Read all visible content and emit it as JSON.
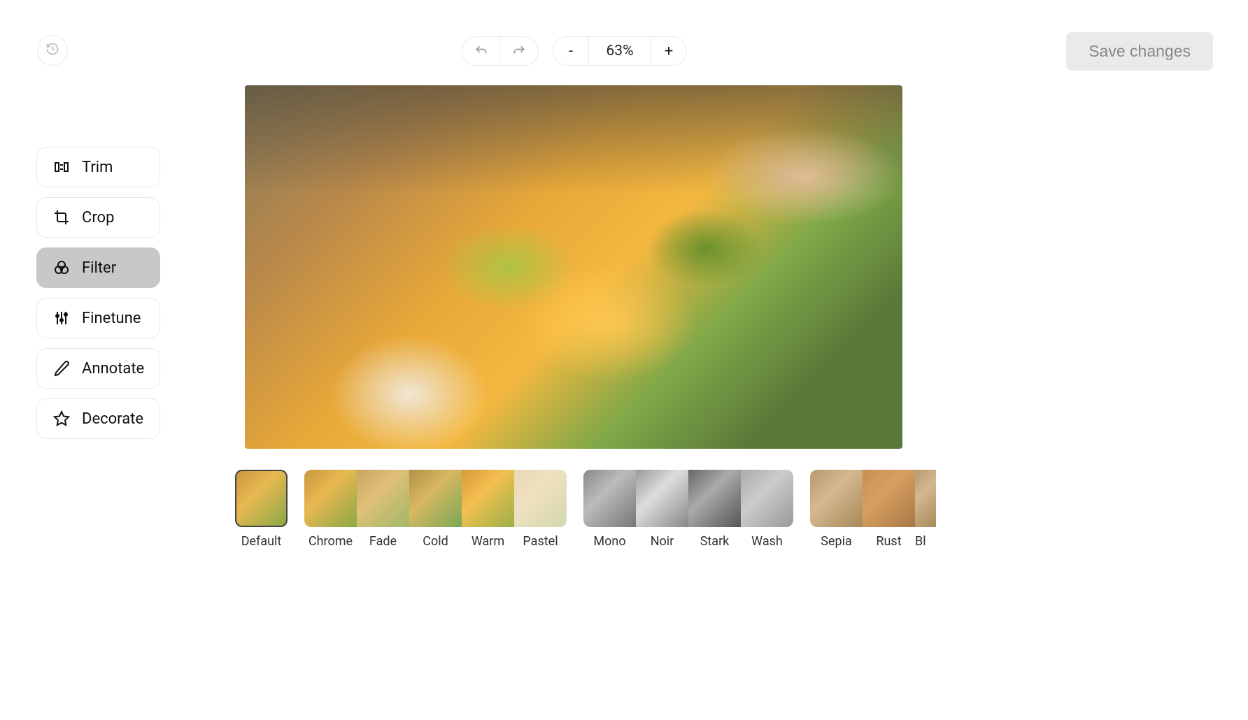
{
  "toolbar": {
    "zoom_value": "63%",
    "zoom_out": "-",
    "zoom_in": "+",
    "save_label": "Save changes"
  },
  "sidebar": {
    "items": [
      {
        "label": "Trim",
        "icon": "trim-icon"
      },
      {
        "label": "Crop",
        "icon": "crop-icon"
      },
      {
        "label": "Filter",
        "icon": "filter-icon",
        "active": true
      },
      {
        "label": "Finetune",
        "icon": "finetune-icon"
      },
      {
        "label": "Annotate",
        "icon": "annotate-icon"
      },
      {
        "label": "Decorate",
        "icon": "decorate-icon"
      }
    ]
  },
  "filters": {
    "selected": "Default",
    "default_label": "Default",
    "group1": [
      {
        "label": "Chrome"
      },
      {
        "label": "Fade"
      },
      {
        "label": "Cold"
      },
      {
        "label": "Warm"
      },
      {
        "label": "Pastel"
      }
    ],
    "group2": [
      {
        "label": "Mono"
      },
      {
        "label": "Noir"
      },
      {
        "label": "Stark"
      },
      {
        "label": "Wash"
      }
    ],
    "group3": [
      {
        "label": "Sepia"
      },
      {
        "label": "Rust"
      },
      {
        "label": "Bl"
      }
    ]
  }
}
